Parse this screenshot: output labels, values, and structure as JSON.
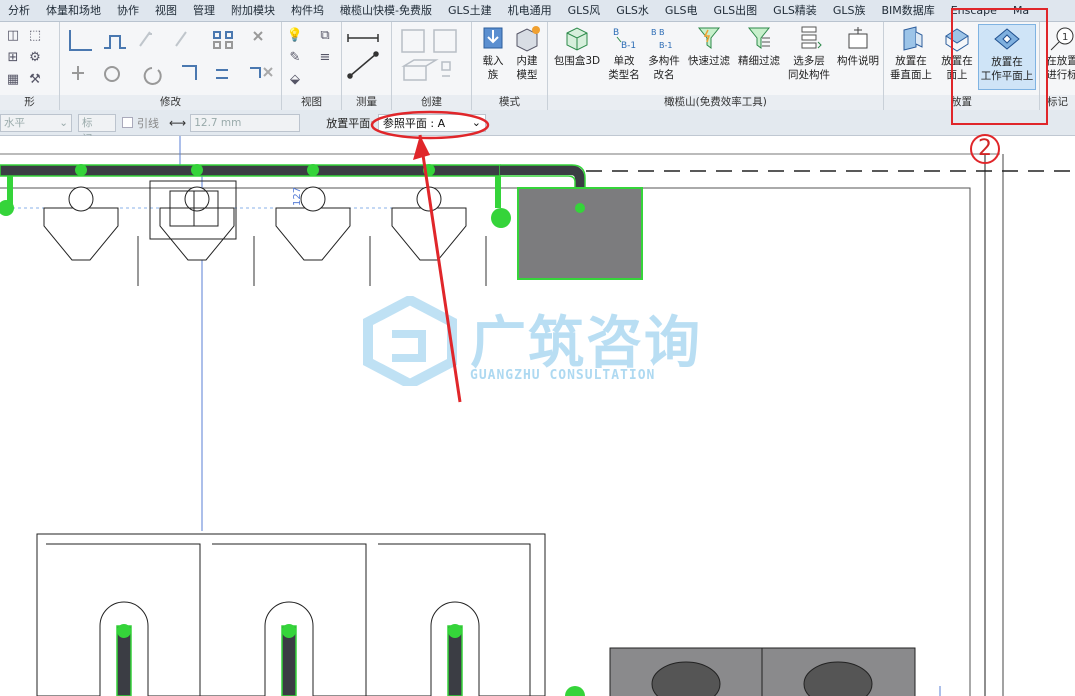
{
  "menu": {
    "tabs": [
      "分析",
      "体量和场地",
      "协作",
      "视图",
      "管理",
      "附加模块",
      "构件坞",
      "橄榄山快模-免费版",
      "GLS土建",
      "机电通用",
      "GLS风",
      "GLS水",
      "GLS电",
      "GLS出图",
      "GLS精装",
      "GLS族",
      "BIM数据库",
      "Enscape",
      "Ma"
    ]
  },
  "ribbon": {
    "panels": {
      "modify": "修改",
      "view": "视图",
      "measure": "测量",
      "create": "创建",
      "mode": "模式",
      "olive": "橄榄山(免费效率工具)",
      "placement": "放置",
      "tag": "标记"
    },
    "mode_buttons": [
      {
        "line1": "载入",
        "line2": "族"
      },
      {
        "line1": "内建",
        "line2": "模型"
      }
    ],
    "olive_buttons": [
      {
        "line1": "包围盒3D",
        "line2": ""
      },
      {
        "line1": "单改",
        "line2": "类型名"
      },
      {
        "line1": "多构件",
        "line2": "改名"
      },
      {
        "line1": "快速过滤",
        "line2": ""
      },
      {
        "line1": "精细过滤",
        "line2": ""
      },
      {
        "line1": "选多层",
        "line2": "同处构件"
      },
      {
        "line1": "构件说明",
        "line2": ""
      }
    ],
    "placement_buttons": [
      {
        "line1": "放置在",
        "line2": "垂直面上"
      },
      {
        "line1": "放置在",
        "line2": "面上"
      },
      {
        "line1": "放置在",
        "line2": "工作平面上"
      }
    ],
    "tag_button": {
      "line1": "在放置",
      "line2": "进行标"
    }
  },
  "options_bar": {
    "orientation": "水平",
    "tag_button": "标记...",
    "leader_label": "引线",
    "leader_length": "12.7 mm",
    "placement_plane_label": "放置平面:",
    "placement_plane_value": "参照平面 : A"
  },
  "canvas": {
    "dimension_text": "127",
    "watermark_cn": "广筑咨询",
    "watermark_en": "GUANGZHU CONSULTATION"
  },
  "annotations": {
    "step_number": "2"
  },
  "colors": {
    "accent_red": "#e0262a",
    "pipe_green": "#35d43a",
    "pipe_dark": "#3b3d44",
    "fixture_gray": "#7c7c7e",
    "ribbon_bg": "#f5f6f8",
    "selected_blue": "#cfe4f7",
    "watermark_blue": "#8cc9ec"
  }
}
